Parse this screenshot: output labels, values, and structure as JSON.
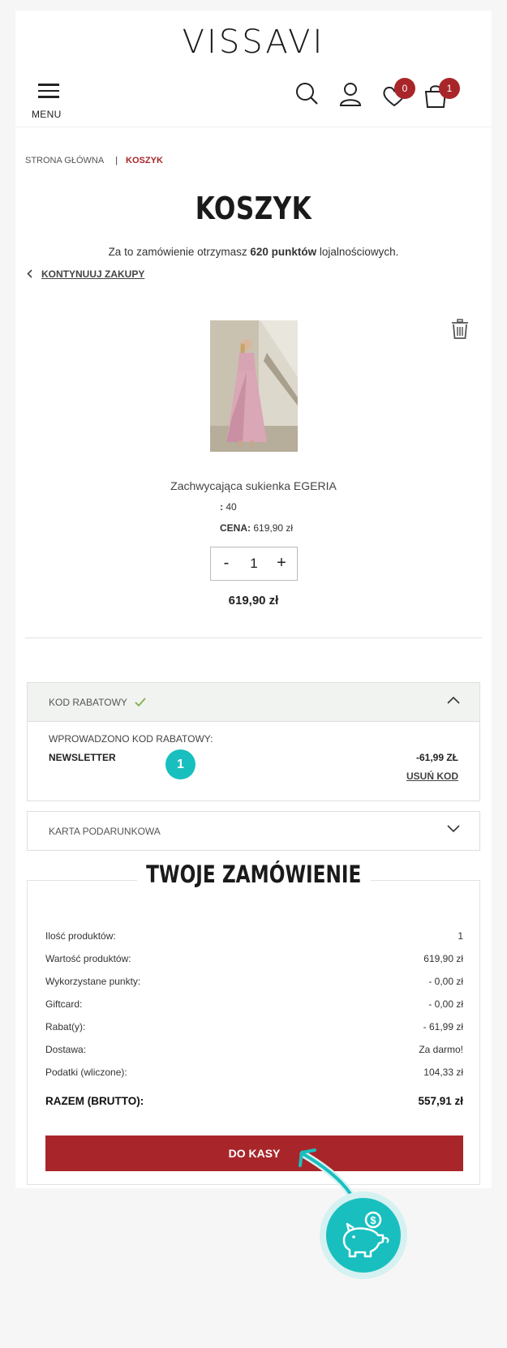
{
  "header": {
    "logo": "VISSAVI",
    "menu_label": "MENU",
    "wishlist_count": "0",
    "cart_count": "1"
  },
  "breadcrumb": {
    "home": "STRONA GŁÓWNA",
    "separator": "|",
    "current": "KOSZYK"
  },
  "page": {
    "title": "KOSZYK",
    "loyalty_prefix": "Za to zamówienie otrzymasz ",
    "loyalty_points": "620 punktów",
    "loyalty_suffix": " lojalnościowych.",
    "continue_label": "KONTYNUUJ ZAKUPY"
  },
  "product": {
    "name": "Zachwycająca sukienka EGERIA",
    "size_label": ":",
    "size_value": "40",
    "price_label": "CENA:",
    "price_value": "619,90 zł",
    "quantity": "1",
    "minus": "-",
    "plus": "+",
    "line_total": "619,90 zł"
  },
  "discount": {
    "header": "KOD RABATOWY",
    "entered_label": "WPROWADZONO KOD RABATOWY:",
    "code": "NEWSLETTER",
    "amount": "-61,99 ZŁ",
    "remove_label": "USUŃ KOD",
    "marker": "1"
  },
  "gift_card": {
    "header": "KARTA PODARUNKOWA"
  },
  "summary": {
    "title": "TWOJE ZAMÓWIENIE",
    "rows": [
      {
        "label": "Ilość produktów:",
        "value": "1"
      },
      {
        "label": "Wartość produktów:",
        "value": "619,90 zł"
      },
      {
        "label": "Wykorzystane punkty:",
        "value": "- 0,00 zł"
      },
      {
        "label": "Giftcard:",
        "value": "- 0,00 zł"
      },
      {
        "label": "Rabat(y):",
        "value": "- 61,99 zł"
      },
      {
        "label": "Dostawa:",
        "value": "Za darmo!"
      },
      {
        "label": "Podatki (wliczone):",
        "value": "104,33 zł"
      }
    ],
    "total_label": "RAZEM (BRUTTO):",
    "total_value": "557,91 zł",
    "checkout_label": "DO KASY"
  },
  "colors": {
    "accent": "#a8262a",
    "annotation": "#19bfbf"
  }
}
